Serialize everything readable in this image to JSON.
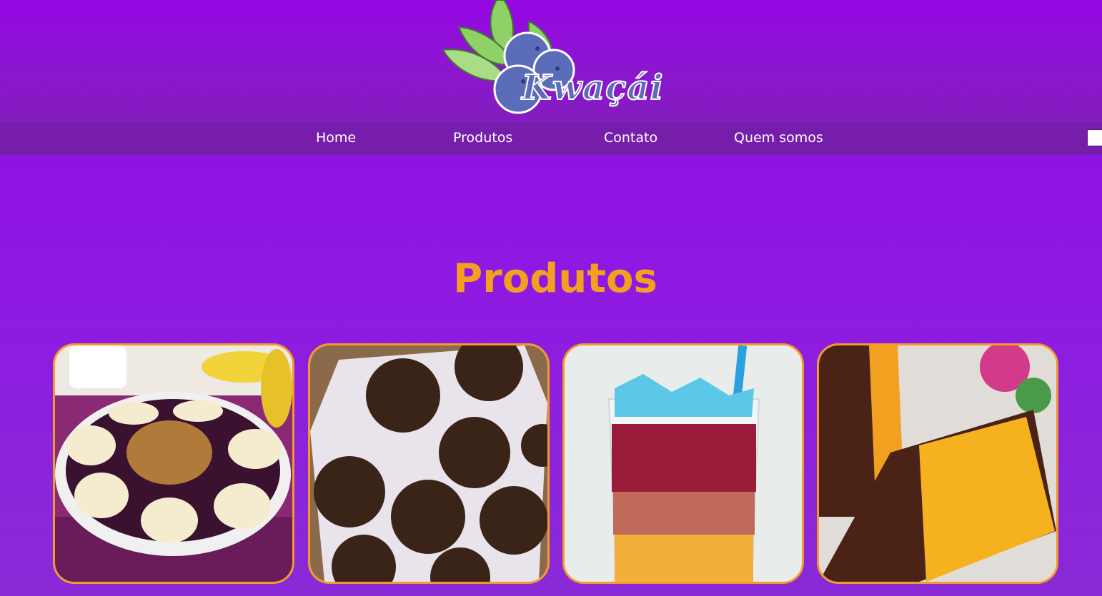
{
  "brand": {
    "logo_text": "Kwaçái",
    "logo_icon": "acai-berries-leaves-logo"
  },
  "nav": {
    "items": [
      {
        "label": "Home"
      },
      {
        "label": "Produtos"
      },
      {
        "label": "Contato"
      },
      {
        "label": "Quem somos"
      }
    ]
  },
  "products_section": {
    "title": "Produtos"
  },
  "products": [
    {
      "image": "acai-bowl-banana-granola"
    },
    {
      "image": "chocolate-brigadeiros"
    },
    {
      "image": "layered-fruit-drink-with-straw"
    },
    {
      "image": "mango-chocolate-popsicles"
    }
  ],
  "colors": {
    "background": "#8f17e4",
    "title": "#f3a020",
    "card_border": "#f29a2a",
    "nav_text": "#ffffff"
  }
}
